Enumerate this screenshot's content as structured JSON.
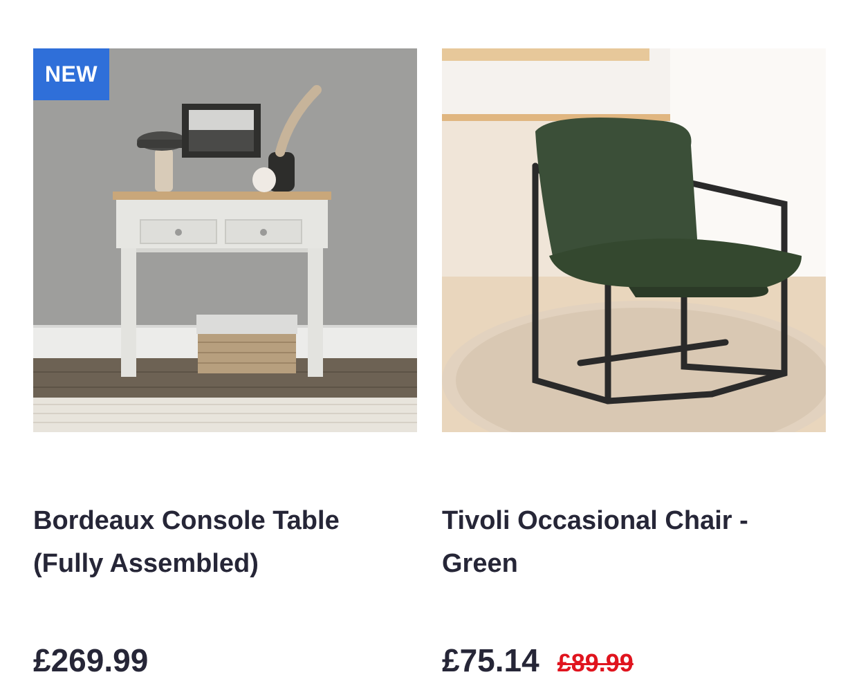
{
  "products": [
    {
      "badge": "NEW",
      "title_line1": "Bordeaux Console Table",
      "title_line2": "(Fully Assembled)",
      "price": "£269.99",
      "image_desc": "console-table"
    },
    {
      "title_line1": "Tivoli Occasional Chair -",
      "title_line2": "Green",
      "price": "£75.14",
      "was_price": "£89.99",
      "image_desc": "green-chair"
    }
  ],
  "colors": {
    "badge_bg": "#2f6fd9",
    "text": "#262637",
    "sale_red": "#e0141e"
  }
}
